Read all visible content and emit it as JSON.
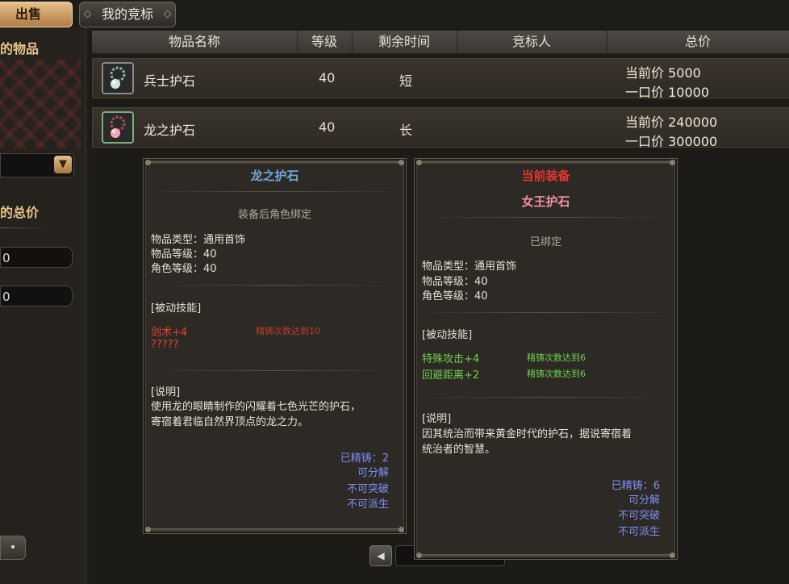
{
  "tabs": {
    "sell": "出售",
    "my_bids": "我的竞标"
  },
  "left": {
    "items_label": "的物品",
    "total_label": "的总价",
    "min_value": "0",
    "max_value": "0",
    "button_label": "•"
  },
  "table": {
    "headers": [
      "物品名称",
      "等级",
      "剩余时间",
      "竞标人",
      "总价"
    ],
    "rows": [
      {
        "name": "兵士护石",
        "level": "40",
        "time": "短",
        "bidder": "",
        "current_label": "当前价",
        "current_price": "5000",
        "buyout_label": "一口价",
        "buyout_price": "10000",
        "rarity": "white"
      },
      {
        "name": "龙之护石",
        "level": "40",
        "time": "长",
        "bidder": "",
        "current_label": "当前价",
        "current_price": "240000",
        "buyout_label": "一口价",
        "buyout_price": "300000",
        "rarity": "green"
      }
    ]
  },
  "tooltip_left": {
    "title": "龙之护石",
    "bind": "装备后角色绑定",
    "type": "物品类型：通用首饰",
    "item_level": "物品等级：40",
    "char_level": "角色等级：40",
    "passive_header": "[被动技能]",
    "skill1": "剑术+4",
    "skill1_req": "精铸次数达到10",
    "skill2": "?????",
    "desc_header": "[说明]",
    "desc_line1": "使用龙的眼睛制作的闪耀着七色光芒的护石，",
    "desc_line2": "寄宿着君临自然界顶点的龙之力。",
    "refined": "已精铸：2",
    "stat1": "可分解",
    "stat2": "不可突破",
    "stat3": "不可派生"
  },
  "tooltip_right": {
    "header": "当前装备",
    "title": "女王护石",
    "bind": "已绑定",
    "type": "物品类型：通用首饰",
    "item_level": "物品等级：40",
    "char_level": "角色等级：40",
    "passive_header": "[被动技能]",
    "skill1": "特殊攻击+4",
    "skill1_req": "精铸次数达到6",
    "skill2": "回避距离+2",
    "skill2_req": "精铸次数达到6",
    "desc_header": "[说明]",
    "desc_line1": "因其统治而带来黄金时代的护石，据说寄宿着",
    "desc_line2": "统治者的智慧。",
    "refined": "已精铸：6",
    "stat1": "可分解",
    "stat2": "不可突破",
    "stat3": "不可派生"
  },
  "pager": {
    "prev_icon": "arrow-left-icon"
  }
}
